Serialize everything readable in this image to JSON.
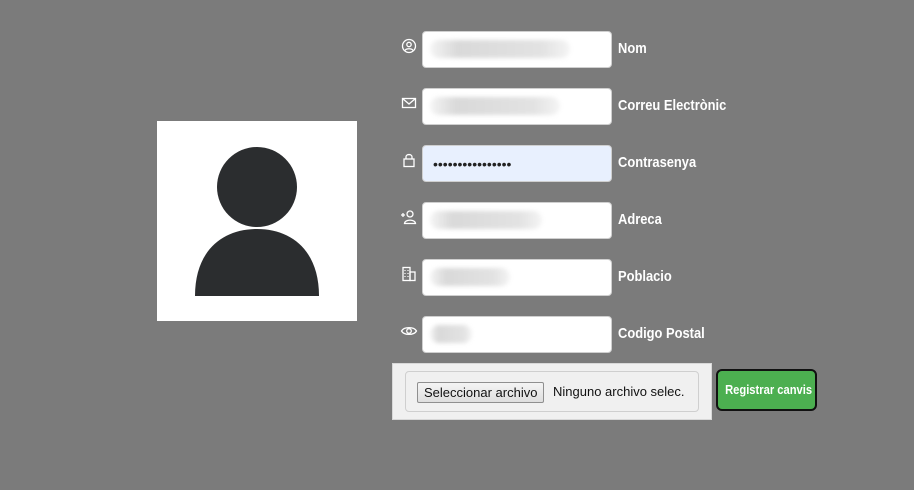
{
  "profile": {
    "avatar_icon": "user-silhouette-icon"
  },
  "form": {
    "fields": [
      {
        "label": "Nom",
        "icon": "user-circle-icon",
        "value": "",
        "type": "text"
      },
      {
        "label": "Correu Electrònic",
        "icon": "envelope-icon",
        "value": "",
        "type": "text"
      },
      {
        "label": "Contrasenya",
        "icon": "lock-icon",
        "value": "••••••••••••••••",
        "type": "password"
      },
      {
        "label": "Adreca",
        "icon": "user-plus-icon",
        "value": "",
        "type": "text"
      },
      {
        "label": "Poblacio",
        "icon": "building-icon",
        "value": "",
        "type": "text"
      },
      {
        "label": "Codigo Postal",
        "icon": "eye-icon",
        "value": "",
        "type": "text"
      }
    ],
    "file_input": {
      "button_label": "Seleccionar archivo",
      "status_text": "Ninguno archivo selec."
    },
    "submit_label": "Registrar canvis"
  },
  "colors": {
    "background": "#7b7b7b",
    "submit": "#4caf50",
    "autofill": "#e8f0fe"
  }
}
